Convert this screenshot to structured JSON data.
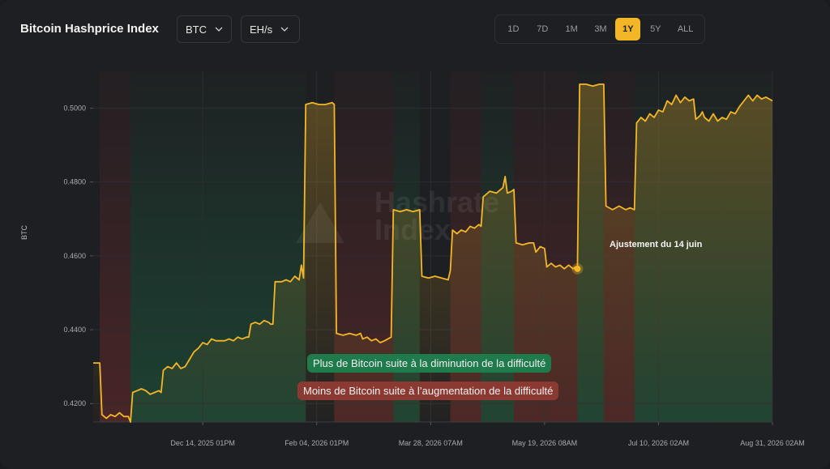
{
  "header": {
    "title": "Bitcoin Hashprice Index",
    "currency_value": "BTC",
    "unit_value": "EH/s",
    "ranges": [
      "1D",
      "7D",
      "1M",
      "3M",
      "1Y",
      "5Y",
      "ALL"
    ],
    "active_range": "1Y"
  },
  "colors": {
    "accent": "#f3b627",
    "increase_band": "#1a8a55",
    "decrease_band": "#8a2e2e"
  },
  "legend": {
    "more_btc": "Plus de Bitcoin suite à la diminution de la difficulté",
    "less_btc": "Moins de Bitcoin suite à l’augmentation de la difficulté"
  },
  "annotation": {
    "label": "Ajustement du 14 juin"
  },
  "chart_data": {
    "type": "area",
    "ylabel": "BTC",
    "ylim": [
      0.415,
      0.51
    ],
    "y_ticks": [
      "0.4200",
      "0.4400",
      "0.4600",
      "0.4800",
      "0.5000"
    ],
    "x_ticks": [
      "Dec 14, 2025 01PM",
      "Feb 04, 2026 01PM",
      "Mar 28, 2026 07AM",
      "May 19, 2026 08AM",
      "Jul 10, 2026 02AM",
      "Aug 31, 2026 02AM"
    ],
    "x_tick_days": [
      105,
      157,
      209,
      261,
      313,
      365
    ],
    "x_range_days": [
      55,
      365
    ],
    "grid": true,
    "series": [
      {
        "points": [
          [
            55,
            0.431
          ],
          [
            58,
            0.431
          ],
          [
            59,
            0.417
          ],
          [
            61,
            0.416
          ],
          [
            63,
            0.417
          ],
          [
            65,
            0.4165
          ],
          [
            67,
            0.4175
          ],
          [
            69,
            0.4165
          ],
          [
            71,
            0.4165
          ],
          [
            72,
            0.415
          ],
          [
            73,
            0.423
          ],
          [
            75,
            0.4235
          ],
          [
            77,
            0.424
          ],
          [
            79,
            0.4235
          ],
          [
            81,
            0.4225
          ],
          [
            83,
            0.423
          ],
          [
            85,
            0.4235
          ],
          [
            86,
            0.423
          ],
          [
            87,
            0.429
          ],
          [
            89,
            0.43
          ],
          [
            91,
            0.4295
          ],
          [
            93,
            0.431
          ],
          [
            95,
            0.4295
          ],
          [
            97,
            0.43
          ],
          [
            99,
            0.432
          ],
          [
            101,
            0.434
          ],
          [
            103,
            0.435
          ],
          [
            105,
            0.4365
          ],
          [
            107,
            0.436
          ],
          [
            109,
            0.4375
          ],
          [
            111,
            0.437
          ],
          [
            113,
            0.437
          ],
          [
            115,
            0.437
          ],
          [
            117,
            0.4375
          ],
          [
            119,
            0.437
          ],
          [
            121,
            0.438
          ],
          [
            123,
            0.4375
          ],
          [
            125,
            0.438
          ],
          [
            126,
            0.438
          ],
          [
            127,
            0.4415
          ],
          [
            129,
            0.442
          ],
          [
            131,
            0.4415
          ],
          [
            133,
            0.4425
          ],
          [
            135,
            0.442
          ],
          [
            136,
            0.4415
          ],
          [
            137,
            0.4415
          ],
          [
            138,
            0.453
          ],
          [
            141,
            0.453
          ],
          [
            143,
            0.4535
          ],
          [
            145,
            0.453
          ],
          [
            147,
            0.4545
          ],
          [
            149,
            0.4535
          ],
          [
            150,
            0.4575
          ],
          [
            151,
            0.454
          ],
          [
            152,
            0.501
          ],
          [
            155,
            0.5015
          ],
          [
            158,
            0.501
          ],
          [
            161,
            0.501
          ],
          [
            164,
            0.5015
          ],
          [
            165,
            0.501
          ],
          [
            166,
            0.439
          ],
          [
            169,
            0.4385
          ],
          [
            172,
            0.439
          ],
          [
            175,
            0.4385
          ],
          [
            177,
            0.439
          ],
          [
            178,
            0.4375
          ],
          [
            180,
            0.438
          ],
          [
            182,
            0.437
          ],
          [
            184,
            0.4375
          ],
          [
            186,
            0.4365
          ],
          [
            188,
            0.437
          ],
          [
            191,
            0.438
          ],
          [
            192,
            0.4725
          ],
          [
            195,
            0.472
          ],
          [
            198,
            0.4725
          ],
          [
            201,
            0.472
          ],
          [
            204,
            0.4725
          ],
          [
            205,
            0.4545
          ],
          [
            208,
            0.454
          ],
          [
            211,
            0.4545
          ],
          [
            214,
            0.454
          ],
          [
            217,
            0.4535
          ],
          [
            218,
            0.456
          ],
          [
            219,
            0.467
          ],
          [
            221,
            0.466
          ],
          [
            223,
            0.467
          ],
          [
            225,
            0.4665
          ],
          [
            227,
            0.468
          ],
          [
            229,
            0.4675
          ],
          [
            231,
            0.4685
          ],
          [
            232,
            0.468
          ],
          [
            233,
            0.476
          ],
          [
            236,
            0.4775
          ],
          [
            239,
            0.477
          ],
          [
            242,
            0.4785
          ],
          [
            243,
            0.4815
          ],
          [
            244,
            0.477
          ],
          [
            246,
            0.4775
          ],
          [
            247,
            0.478
          ],
          [
            248,
            0.4635
          ],
          [
            251,
            0.463
          ],
          [
            254,
            0.4635
          ],
          [
            256,
            0.4635
          ],
          [
            257,
            0.461
          ],
          [
            259,
            0.4625
          ],
          [
            261,
            0.462
          ],
          [
            262,
            0.457
          ],
          [
            264,
            0.458
          ],
          [
            266,
            0.457
          ],
          [
            268,
            0.4575
          ],
          [
            270,
            0.4565
          ],
          [
            272,
            0.4575
          ],
          [
            274,
            0.4565
          ],
          [
            275,
            0.457
          ],
          [
            276,
            0.4565
          ],
          [
            277,
            0.5065
          ],
          [
            280,
            0.5065
          ],
          [
            283,
            0.506
          ],
          [
            286,
            0.5065
          ],
          [
            288,
            0.5065
          ],
          [
            289,
            0.4735
          ],
          [
            292,
            0.4725
          ],
          [
            295,
            0.4735
          ],
          [
            298,
            0.4725
          ],
          [
            300,
            0.473
          ],
          [
            302,
            0.4725
          ],
          [
            303,
            0.496
          ],
          [
            305,
            0.4975
          ],
          [
            307,
            0.4965
          ],
          [
            309,
            0.4985
          ],
          [
            311,
            0.4975
          ],
          [
            313,
            0.4995
          ],
          [
            315,
            0.499
          ],
          [
            317,
            0.502
          ],
          [
            319,
            0.501
          ],
          [
            321,
            0.5035
          ],
          [
            323,
            0.5015
          ],
          [
            325,
            0.503
          ],
          [
            327,
            0.502
          ],
          [
            329,
            0.5025
          ],
          [
            330,
            0.497
          ],
          [
            332,
            0.498
          ],
          [
            333,
            0.499
          ],
          [
            334,
            0.4975
          ],
          [
            336,
            0.4965
          ],
          [
            338,
            0.4985
          ],
          [
            340,
            0.4965
          ],
          [
            342,
            0.4975
          ],
          [
            344,
            0.497
          ],
          [
            346,
            0.499
          ],
          [
            348,
            0.4985
          ],
          [
            350,
            0.5005
          ],
          [
            352,
            0.502
          ],
          [
            354,
            0.5035
          ],
          [
            356,
            0.502
          ],
          [
            358,
            0.5035
          ],
          [
            360,
            0.5025
          ],
          [
            362,
            0.503
          ],
          [
            365,
            0.502
          ]
        ]
      }
    ],
    "bands": [
      {
        "from": 58,
        "to": 72,
        "kind": "decrease"
      },
      {
        "from": 72,
        "to": 152,
        "kind": "increase"
      },
      {
        "from": 165,
        "to": 192,
        "kind": "decrease"
      },
      {
        "from": 192,
        "to": 204,
        "kind": "increase"
      },
      {
        "from": 218,
        "to": 232,
        "kind": "decrease"
      },
      {
        "from": 232,
        "to": 247,
        "kind": "increase"
      },
      {
        "from": 247,
        "to": 262,
        "kind": "decrease"
      },
      {
        "from": 262,
        "to": 276,
        "kind": "decrease"
      },
      {
        "from": 276,
        "to": 288,
        "kind": "increase"
      },
      {
        "from": 288,
        "to": 302,
        "kind": "decrease"
      },
      {
        "from": 302,
        "to": 365,
        "kind": "increase"
      }
    ],
    "annotation_point": [
      276,
      0.4565
    ]
  }
}
